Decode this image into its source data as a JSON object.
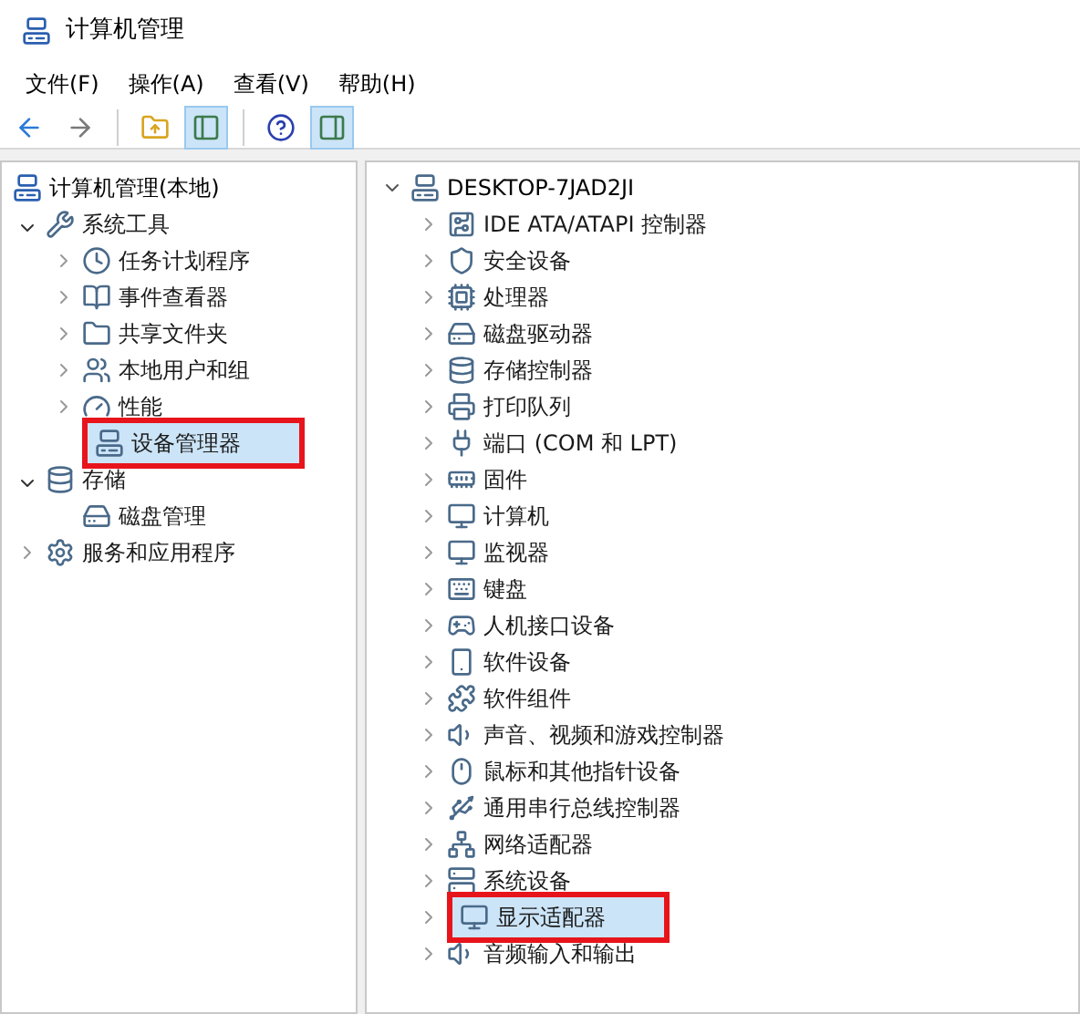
{
  "window": {
    "title": "计算机管理"
  },
  "menu": [
    "文件(F)",
    "操作(A)",
    "查看(V)",
    "帮助(H)"
  ],
  "toolbar": [
    {
      "pressed": false
    },
    {
      "pressed": false
    },
    {
      "pressed": false
    },
    {
      "pressed": true
    },
    {
      "pressed": false
    },
    {
      "pressed": true
    }
  ],
  "console_tree": {
    "label": "计算机管理(本地)",
    "children": [
      {
        "label": "系统工具",
        "expanded": true,
        "highlighted": false,
        "children": [
          {
            "label": "任务计划程序",
            "expanded": false,
            "highlighted": false
          },
          {
            "label": "事件查看器",
            "expanded": false,
            "highlighted": false
          },
          {
            "label": "共享文件夹",
            "expanded": false,
            "highlighted": false
          },
          {
            "label": "本地用户和组",
            "expanded": false,
            "highlighted": false
          },
          {
            "label": "性能",
            "expanded": false,
            "highlighted": false
          },
          {
            "label": "设备管理器",
            "highlighted": true
          }
        ]
      },
      {
        "label": "存储",
        "expanded": true,
        "highlighted": false,
        "children": [
          {
            "label": "磁盘管理",
            "highlighted": false
          }
        ]
      },
      {
        "label": "服务和应用程序",
        "expanded": false,
        "highlighted": false
      }
    ]
  },
  "device_tree": {
    "computer": "DESKTOP-7JAD2JI",
    "categories": [
      {
        "label": "IDE ATA/ATAPI 控制器",
        "highlighted": false
      },
      {
        "label": "安全设备",
        "highlighted": false
      },
      {
        "label": "处理器",
        "highlighted": false
      },
      {
        "label": "磁盘驱动器",
        "highlighted": false
      },
      {
        "label": "存储控制器",
        "highlighted": false
      },
      {
        "label": "打印队列",
        "highlighted": false
      },
      {
        "label": "端口 (COM 和 LPT)",
        "highlighted": false
      },
      {
        "label": "固件",
        "highlighted": false
      },
      {
        "label": "计算机",
        "highlighted": false
      },
      {
        "label": "监视器",
        "highlighted": false
      },
      {
        "label": "键盘",
        "highlighted": false
      },
      {
        "label": "人机接口设备",
        "highlighted": false
      },
      {
        "label": "软件设备",
        "highlighted": false
      },
      {
        "label": "软件组件",
        "highlighted": false
      },
      {
        "label": "声音、视频和游戏控制器",
        "highlighted": false
      },
      {
        "label": "鼠标和其他指针设备",
        "highlighted": false
      },
      {
        "label": "通用串行总线控制器",
        "highlighted": false
      },
      {
        "label": "网络适配器",
        "highlighted": false
      },
      {
        "label": "系统设备",
        "highlighted": false
      },
      {
        "label": "显示适配器",
        "highlighted": true
      },
      {
        "label": "音频输入和输出",
        "highlighted": false
      }
    ]
  }
}
